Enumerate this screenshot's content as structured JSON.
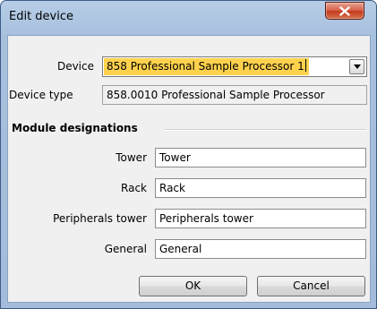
{
  "window": {
    "title": "Edit device",
    "close_icon": "close-x-icon"
  },
  "form": {
    "device_label": "Device",
    "device_value": "858 Professional Sample Processor 1",
    "device_dropdown_icon": "chevron-down-icon",
    "device_type_label": "Device type",
    "device_type_value": "858.0010 Professional Sample Processor"
  },
  "module_designations": {
    "title": "Module designations",
    "fields": [
      {
        "label": "Tower",
        "value": "Tower"
      },
      {
        "label": "Rack",
        "value": "Rack"
      },
      {
        "label": "Peripherals tower",
        "value": "Peripherals tower"
      },
      {
        "label": "General",
        "value": "General"
      }
    ]
  },
  "buttons": {
    "ok": "OK",
    "cancel": "Cancel"
  },
  "colors": {
    "selection_highlight": "#ffd24d",
    "close_button": "#c43b1f",
    "frame": "#a7c0de"
  }
}
